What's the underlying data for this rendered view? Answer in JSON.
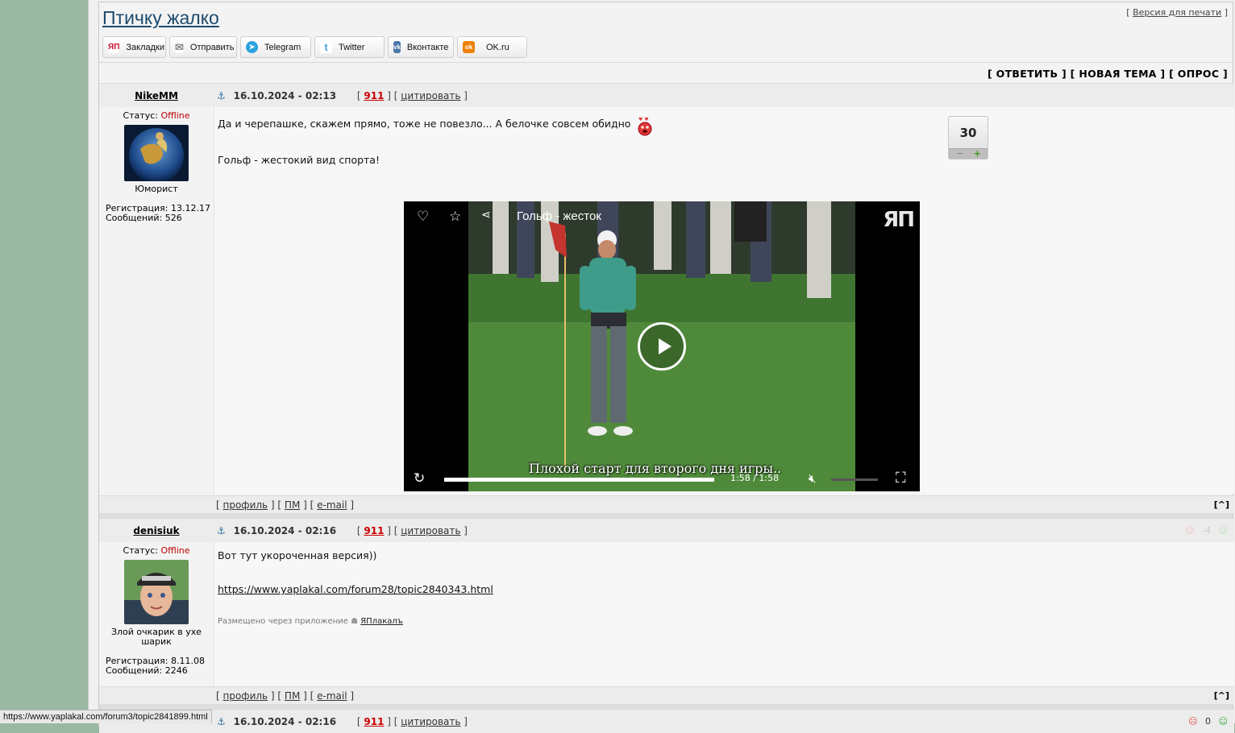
{
  "topic": {
    "title": "Птичку жалко",
    "print_prefix": "[ ",
    "print_link": "Версия для печати",
    "print_suffix": " ]"
  },
  "share": [
    {
      "label": "Закладки",
      "icon": "yap-icon",
      "glyph": "ЯП",
      "color": "#c8102e"
    },
    {
      "label": "Отправить",
      "icon": "mail-icon",
      "glyph": "✉",
      "color": "#9a9a9a"
    },
    {
      "label": "Telegram",
      "icon": "telegram-icon",
      "glyph": "➤",
      "color": "#2aa3df"
    },
    {
      "label": "Twitter",
      "icon": "twitter-icon",
      "glyph": "t",
      "color": "#4aa6e0"
    },
    {
      "label": "Вконтакте",
      "icon": "vk-icon",
      "glyph": "vk",
      "color": "#4a76a8"
    },
    {
      "label": "OK.ru",
      "icon": "ok-icon",
      "glyph": "ok",
      "color": "#ee8208"
    }
  ],
  "actions": {
    "reply": "[ ОТВЕТИТЬ ]",
    "new_topic": "[ НОВАЯ ТЕМА ]",
    "poll": "[ ОПРОС ]"
  },
  "posts": [
    {
      "author": "NikeMM",
      "status_label": "Статус: ",
      "status": "Offline",
      "rank": "Юморист",
      "reg": "Регистрация: 13.12.17",
      "msgs": "Сообщений: 526",
      "date": "16.10.2024 - 02:13",
      "num": "911",
      "quote": "цитировать",
      "text1": "Да и черепашке, скажем прямо, тоже не повезло... А белочке совсем обидно",
      "text2": "Гольф - жестокий вид спорта!",
      "rating": "30",
      "rating_minus": "−",
      "rating_plus": "+",
      "video": {
        "title": "Гольф - жесток",
        "logo": "ЯП",
        "subtitle": "Плохой старт для второго дня игры..",
        "time": "1:58   /  1:58",
        "progress": 1.0
      }
    },
    {
      "author": "denisiuk",
      "status_label": "Статус: ",
      "status": "Offline",
      "rank": "Злой очкарик в ухе шарик",
      "reg": "Регистрация: 8.11.08",
      "msgs": "Сообщений: 2246",
      "date": "16.10.2024 - 02:16",
      "num": "911",
      "quote": "цитировать",
      "text1": "Вот тут укороченная версия))",
      "link": "https://www.yaplakal.com/forum28/topic2840343.html",
      "app_prefix": "Размещено через приложение",
      "app_link": "ЯПлакалъ",
      "rating": "-4"
    },
    {
      "date": "16.10.2024 - 02:16",
      "num": "911",
      "quote": "цитировать",
      "rating": "0"
    }
  ],
  "foot": {
    "profile": "профиль",
    "pm": "ПМ",
    "email": "e-mail",
    "up": "[^]"
  },
  "statusbar": "https://www.yaplakal.com/forum3/topic2841899.html"
}
